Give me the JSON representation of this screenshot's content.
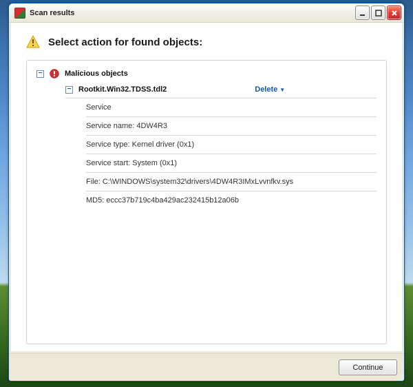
{
  "titlebar": {
    "title": "Scan results"
  },
  "header": {
    "title": "Select action for found objects:"
  },
  "group": {
    "label": "Malicious objects"
  },
  "threat": {
    "name": "Rootkit.Win32.TDSS.tdl2",
    "action_label": "Delete"
  },
  "details": {
    "service_header": "Service",
    "service_name": "Service name: 4DW4R3",
    "service_type": "Service type: Kernel driver (0x1)",
    "service_start": "Service start: System (0x1)",
    "file": "File: C:\\WINDOWS\\system32\\drivers\\4DW4R3IMxLvvnfkv.sys",
    "md5": "MD5: eccc37b719c4ba429ac232415b12a06b"
  },
  "footer": {
    "continue_label": "Continue"
  }
}
